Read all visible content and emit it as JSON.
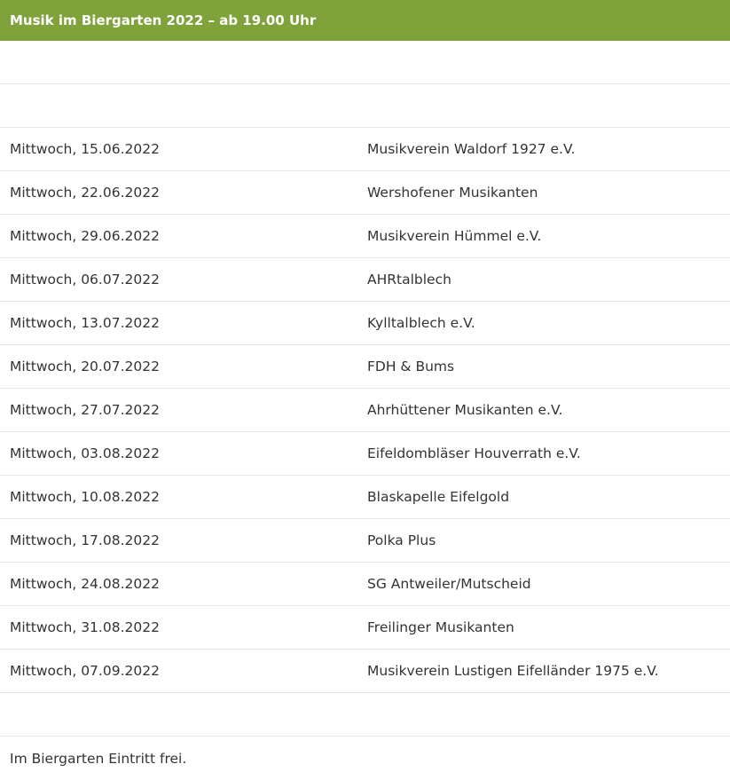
{
  "header": {
    "title": "Musik im Biergarten 2022 – ab 19.00 Uhr"
  },
  "schedule": [
    {
      "date": "Mittwoch, 15.06.2022",
      "band": "Musikverein Waldorf 1927 e.V."
    },
    {
      "date": "Mittwoch, 22.06.2022",
      "band": "Wershofener Musikanten"
    },
    {
      "date": "Mittwoch, 29.06.2022",
      "band": "Musikverein Hümmel e.V."
    },
    {
      "date": "Mittwoch, 06.07.2022",
      "band": "AHRtalblech"
    },
    {
      "date": "Mittwoch, 13.07.2022",
      "band": "Kylltalblech e.V."
    },
    {
      "date": "Mittwoch, 20.07.2022",
      "band": "FDH & Bums"
    },
    {
      "date": "Mittwoch, 27.07.2022",
      "band": "Ahrhüttener Musikanten e.V."
    },
    {
      "date": "Mittwoch, 03.08.2022",
      "band": "Eifeldombläser Houverrath e.V."
    },
    {
      "date": "Mittwoch, 10.08.2022",
      "band": "Blaskapelle Eifelgold"
    },
    {
      "date": "Mittwoch, 17.08.2022",
      "band": "Polka Plus"
    },
    {
      "date": "Mittwoch, 24.08.2022",
      "band": "SG Antweiler/Mutscheid"
    },
    {
      "date": "Mittwoch, 31.08.2022",
      "band": "Freilinger Musikanten"
    },
    {
      "date": "Mittwoch, 07.09.2022",
      "band": "Musikverein Lustigen Eifelländer 1975 e.V."
    }
  ],
  "footer": {
    "note": "Im Biergarten Eintritt frei."
  },
  "colors": {
    "header_bg": "#7fa33a",
    "header_text": "#ffffff",
    "row_border": "#e8e8e8",
    "text": "#333333"
  }
}
